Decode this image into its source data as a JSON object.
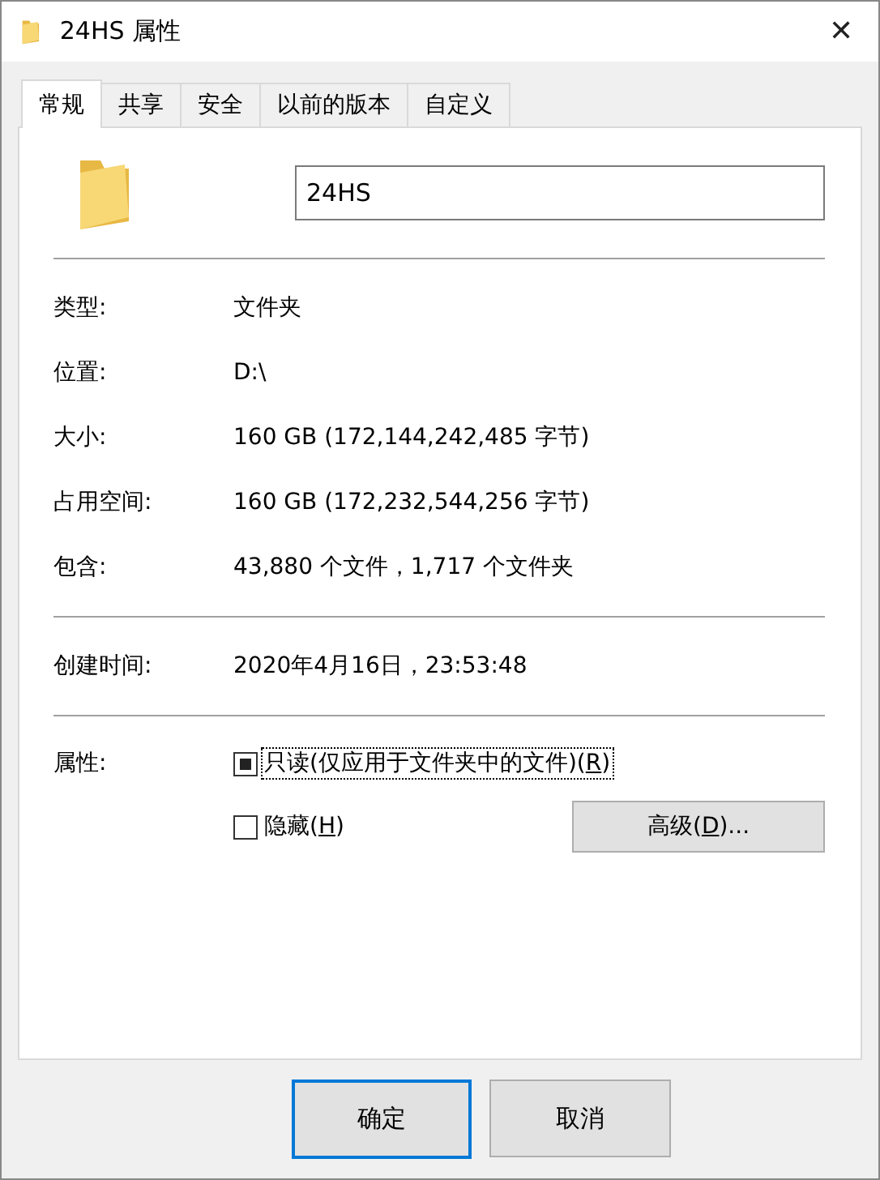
{
  "window": {
    "title": "24HS 属性",
    "close": "✕"
  },
  "tabs": [
    {
      "label": "常规",
      "selected": true
    },
    {
      "label": "共享",
      "selected": false
    },
    {
      "label": "安全",
      "selected": false
    },
    {
      "label": "以前的版本",
      "selected": false
    },
    {
      "label": "自定义",
      "selected": false
    }
  ],
  "name_field": {
    "value": "24HS"
  },
  "info_groups": [
    [
      {
        "label": "类型:",
        "value": "文件夹"
      },
      {
        "label": "位置:",
        "value": "D:\\"
      },
      {
        "label": "大小:",
        "value": "160 GB (172,144,242,485 字节)"
      },
      {
        "label": "占用空间:",
        "value": "160 GB (172,232,544,256 字节)"
      },
      {
        "label": "包含:",
        "value": "43,880 个文件，1,717 个文件夹"
      }
    ],
    [
      {
        "label": "创建时间:",
        "value": "2020年4月16日，23:53:48"
      }
    ]
  ],
  "attributes": {
    "label": "属性:",
    "checkboxes": [
      {
        "before": "只读(仅应用于文件夹中的文件)(",
        "mnemonic": "R",
        "after": ")",
        "checked": false,
        "indeterminate": true,
        "focused": true
      },
      {
        "before": "隐藏(",
        "mnemonic": "H",
        "after": ")",
        "checked": false,
        "indeterminate": false,
        "focused": false
      }
    ],
    "advanced": {
      "before": "高级(",
      "mnemonic": "D",
      "after": ")..."
    }
  },
  "buttons": [
    {
      "label": "确定",
      "default": true
    },
    {
      "label": "取消",
      "default": false
    }
  ]
}
